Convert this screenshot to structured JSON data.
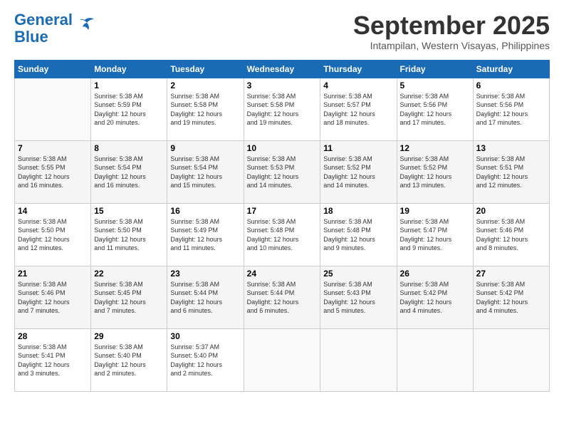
{
  "header": {
    "logo_general": "General",
    "logo_blue": "Blue",
    "month_title": "September 2025",
    "subtitle": "Intampilan, Western Visayas, Philippines"
  },
  "days_of_week": [
    "Sunday",
    "Monday",
    "Tuesday",
    "Wednesday",
    "Thursday",
    "Friday",
    "Saturday"
  ],
  "weeks": [
    [
      {
        "day": "",
        "info": ""
      },
      {
        "day": "1",
        "info": "Sunrise: 5:38 AM\nSunset: 5:59 PM\nDaylight: 12 hours\nand 20 minutes."
      },
      {
        "day": "2",
        "info": "Sunrise: 5:38 AM\nSunset: 5:58 PM\nDaylight: 12 hours\nand 19 minutes."
      },
      {
        "day": "3",
        "info": "Sunrise: 5:38 AM\nSunset: 5:58 PM\nDaylight: 12 hours\nand 19 minutes."
      },
      {
        "day": "4",
        "info": "Sunrise: 5:38 AM\nSunset: 5:57 PM\nDaylight: 12 hours\nand 18 minutes."
      },
      {
        "day": "5",
        "info": "Sunrise: 5:38 AM\nSunset: 5:56 PM\nDaylight: 12 hours\nand 17 minutes."
      },
      {
        "day": "6",
        "info": "Sunrise: 5:38 AM\nSunset: 5:56 PM\nDaylight: 12 hours\nand 17 minutes."
      }
    ],
    [
      {
        "day": "7",
        "info": "Sunrise: 5:38 AM\nSunset: 5:55 PM\nDaylight: 12 hours\nand 16 minutes."
      },
      {
        "day": "8",
        "info": "Sunrise: 5:38 AM\nSunset: 5:54 PM\nDaylight: 12 hours\nand 16 minutes."
      },
      {
        "day": "9",
        "info": "Sunrise: 5:38 AM\nSunset: 5:54 PM\nDaylight: 12 hours\nand 15 minutes."
      },
      {
        "day": "10",
        "info": "Sunrise: 5:38 AM\nSunset: 5:53 PM\nDaylight: 12 hours\nand 14 minutes."
      },
      {
        "day": "11",
        "info": "Sunrise: 5:38 AM\nSunset: 5:52 PM\nDaylight: 12 hours\nand 14 minutes."
      },
      {
        "day": "12",
        "info": "Sunrise: 5:38 AM\nSunset: 5:52 PM\nDaylight: 12 hours\nand 13 minutes."
      },
      {
        "day": "13",
        "info": "Sunrise: 5:38 AM\nSunset: 5:51 PM\nDaylight: 12 hours\nand 12 minutes."
      }
    ],
    [
      {
        "day": "14",
        "info": "Sunrise: 5:38 AM\nSunset: 5:50 PM\nDaylight: 12 hours\nand 12 minutes."
      },
      {
        "day": "15",
        "info": "Sunrise: 5:38 AM\nSunset: 5:50 PM\nDaylight: 12 hours\nand 11 minutes."
      },
      {
        "day": "16",
        "info": "Sunrise: 5:38 AM\nSunset: 5:49 PM\nDaylight: 12 hours\nand 11 minutes."
      },
      {
        "day": "17",
        "info": "Sunrise: 5:38 AM\nSunset: 5:48 PM\nDaylight: 12 hours\nand 10 minutes."
      },
      {
        "day": "18",
        "info": "Sunrise: 5:38 AM\nSunset: 5:48 PM\nDaylight: 12 hours\nand 9 minutes."
      },
      {
        "day": "19",
        "info": "Sunrise: 5:38 AM\nSunset: 5:47 PM\nDaylight: 12 hours\nand 9 minutes."
      },
      {
        "day": "20",
        "info": "Sunrise: 5:38 AM\nSunset: 5:46 PM\nDaylight: 12 hours\nand 8 minutes."
      }
    ],
    [
      {
        "day": "21",
        "info": "Sunrise: 5:38 AM\nSunset: 5:46 PM\nDaylight: 12 hours\nand 7 minutes."
      },
      {
        "day": "22",
        "info": "Sunrise: 5:38 AM\nSunset: 5:45 PM\nDaylight: 12 hours\nand 7 minutes."
      },
      {
        "day": "23",
        "info": "Sunrise: 5:38 AM\nSunset: 5:44 PM\nDaylight: 12 hours\nand 6 minutes."
      },
      {
        "day": "24",
        "info": "Sunrise: 5:38 AM\nSunset: 5:44 PM\nDaylight: 12 hours\nand 6 minutes."
      },
      {
        "day": "25",
        "info": "Sunrise: 5:38 AM\nSunset: 5:43 PM\nDaylight: 12 hours\nand 5 minutes."
      },
      {
        "day": "26",
        "info": "Sunrise: 5:38 AM\nSunset: 5:42 PM\nDaylight: 12 hours\nand 4 minutes."
      },
      {
        "day": "27",
        "info": "Sunrise: 5:38 AM\nSunset: 5:42 PM\nDaylight: 12 hours\nand 4 minutes."
      }
    ],
    [
      {
        "day": "28",
        "info": "Sunrise: 5:38 AM\nSunset: 5:41 PM\nDaylight: 12 hours\nand 3 minutes."
      },
      {
        "day": "29",
        "info": "Sunrise: 5:38 AM\nSunset: 5:40 PM\nDaylight: 12 hours\nand 2 minutes."
      },
      {
        "day": "30",
        "info": "Sunrise: 5:37 AM\nSunset: 5:40 PM\nDaylight: 12 hours\nand 2 minutes."
      },
      {
        "day": "",
        "info": ""
      },
      {
        "day": "",
        "info": ""
      },
      {
        "day": "",
        "info": ""
      },
      {
        "day": "",
        "info": ""
      }
    ]
  ]
}
